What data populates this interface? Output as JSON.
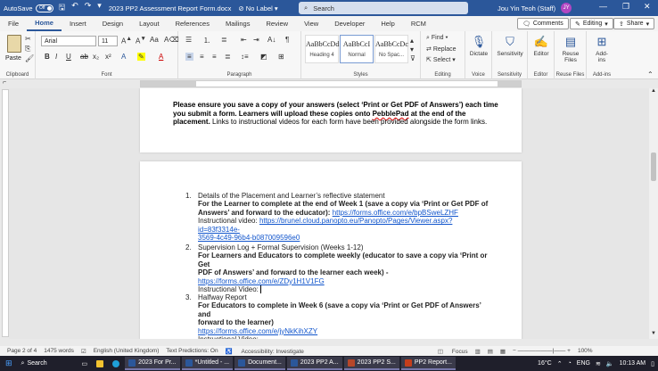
{
  "titlebar": {
    "autosave": "AutoSave",
    "autosave_state": "Off",
    "doc_name": "2023 PP2 Assessment Report Form.docx",
    "label": "No Label",
    "search": "Search",
    "user": "Jou Yin Teoh (Staff)",
    "avatar": "JY"
  },
  "menu": {
    "tabs": [
      "File",
      "Home",
      "Insert",
      "Design",
      "Layout",
      "References",
      "Mailings",
      "Review",
      "View",
      "Developer",
      "Help",
      "RCM"
    ],
    "comments": "Comments",
    "editing": "Editing",
    "share": "Share"
  },
  "ribbon": {
    "clipboard": {
      "paste": "Paste",
      "label": "Clipboard"
    },
    "font": {
      "name": "Arial",
      "size": "11",
      "label": "Font"
    },
    "paragraph": {
      "label": "Paragraph"
    },
    "styles": {
      "label": "Styles",
      "items": [
        {
          "sample": "AaBbCcDd",
          "name": "Heading 4"
        },
        {
          "sample": "AaBbCcI",
          "name": "Normal"
        },
        {
          "sample": "AaBbCcDc",
          "name": "No Spac..."
        }
      ]
    },
    "editing": {
      "find": "Find",
      "replace": "Replace",
      "select": "Select",
      "label": "Editing"
    },
    "voice": {
      "dictate": "Dictate",
      "label": "Voice"
    },
    "sensitivity": {
      "btn": "Sensitivity",
      "label": "Sensitivity"
    },
    "editor": {
      "btn": "Editor",
      "label": "Editor"
    },
    "reuse": {
      "btn1": "Reuse",
      "btn2": "Files",
      "label": "Reuse Files"
    },
    "addins": {
      "btn1": "Add-",
      "btn2": "ins",
      "label": "Add-ins"
    }
  },
  "doc": {
    "p1_line1": "Please ensure you save a copy of your answers (select ‘Print or Get PDF of Answers’) each time",
    "p1_line2a": "you submit a form. Learners will upload these copies onto ",
    "p1_pebble": "PebblePad",
    "p1_line2b": " at the end of the",
    "p1_line3a": "placement.",
    "p1_line3b": " Links to instructional videos for each form have been provided alongside the form links.",
    "items": [
      {
        "num": "1.",
        "title": "Details of the Placement and Learner’s reflective statement",
        "bold1": "For the Learner to complete at the end of Week 1 (save a copy via ‘Print or Get PDF of",
        "bold2": "Answers’ and forward to the educator):",
        "link1": "https://forms.office.com/e/bpBSweLZHF",
        "video_label": "Instructional video:",
        "video_link1": "https://brunel.cloud.panopto.eu/Panopto/Pages/Viewer.aspx?id=83f3314e-",
        "video_link2": "3569-4c49-96b4-b087009596e0"
      },
      {
        "num": "2.",
        "title": "Supervision Log + Formal Supervision (Weeks 1-12)",
        "bold1": "For Learners and Educators to complete weekly (educator to save a copy via ‘Print or Get",
        "bold2": "PDF of Answers’ and forward to the learner each week) -",
        "link1": "https://forms.office.com/e/ZDy1H1V1FG",
        "video_label": "Instructional Video:"
      },
      {
        "num": "3.",
        "title": "Halfway Report",
        "bold1": "For Educators to complete in Week 6 (save a copy via ‘Print or Get PDF of Answers’ and",
        "bold2": "forward to the learner)",
        "link1": "https://forms.office.com/e/jyNkKihXZY",
        "video_label": "Instructional Video:"
      }
    ]
  },
  "status": {
    "page": "Page 2 of 4",
    "words": "1475 words",
    "lang": "English (United Kingdom)",
    "predict": "Text Predictions: On",
    "access": "Accessibility: Investigate",
    "focus": "Focus",
    "zoom": "100%"
  },
  "taskbar": {
    "search": "Search",
    "apps": [
      "2023 For Pr...",
      "*Untitled - ...",
      "Document...",
      "2023 PP2 A...",
      "2023 PP2 S...",
      "PP2 Report..."
    ],
    "weather": "16°C",
    "lang": "ENG",
    "time": "10:13 AM"
  }
}
